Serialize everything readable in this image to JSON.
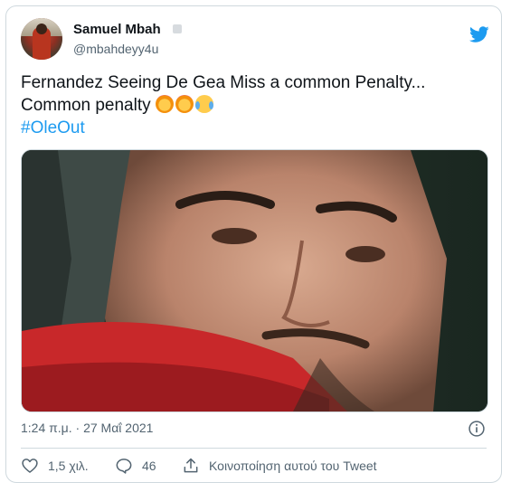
{
  "author": {
    "name": "Samuel Mbah",
    "handle": "@mbahdeyy4u"
  },
  "tweet": {
    "line1": "Fernandez Seeing De Gea Miss a common Penalty...",
    "line2": "Common penalty",
    "hashtag": "#OleOut",
    "emojis": [
      "person-gesturing-no",
      "person-gesturing-no",
      "face-with-tears-of-joy"
    ]
  },
  "timestamp": "1:24 π.μ. · 27 Μαΐ 2021",
  "actions": {
    "likes": "1,5 χιλ.",
    "replies": "46",
    "share_label": "Κοινοποίηση αυτού του Tweet"
  },
  "colors": {
    "accent": "#1d9bf0",
    "secondary_text": "#536471",
    "border": "#cfd9de"
  },
  "icons": [
    "twitter-bird-icon",
    "info-icon",
    "heart-icon",
    "reply-icon",
    "share-icon"
  ]
}
